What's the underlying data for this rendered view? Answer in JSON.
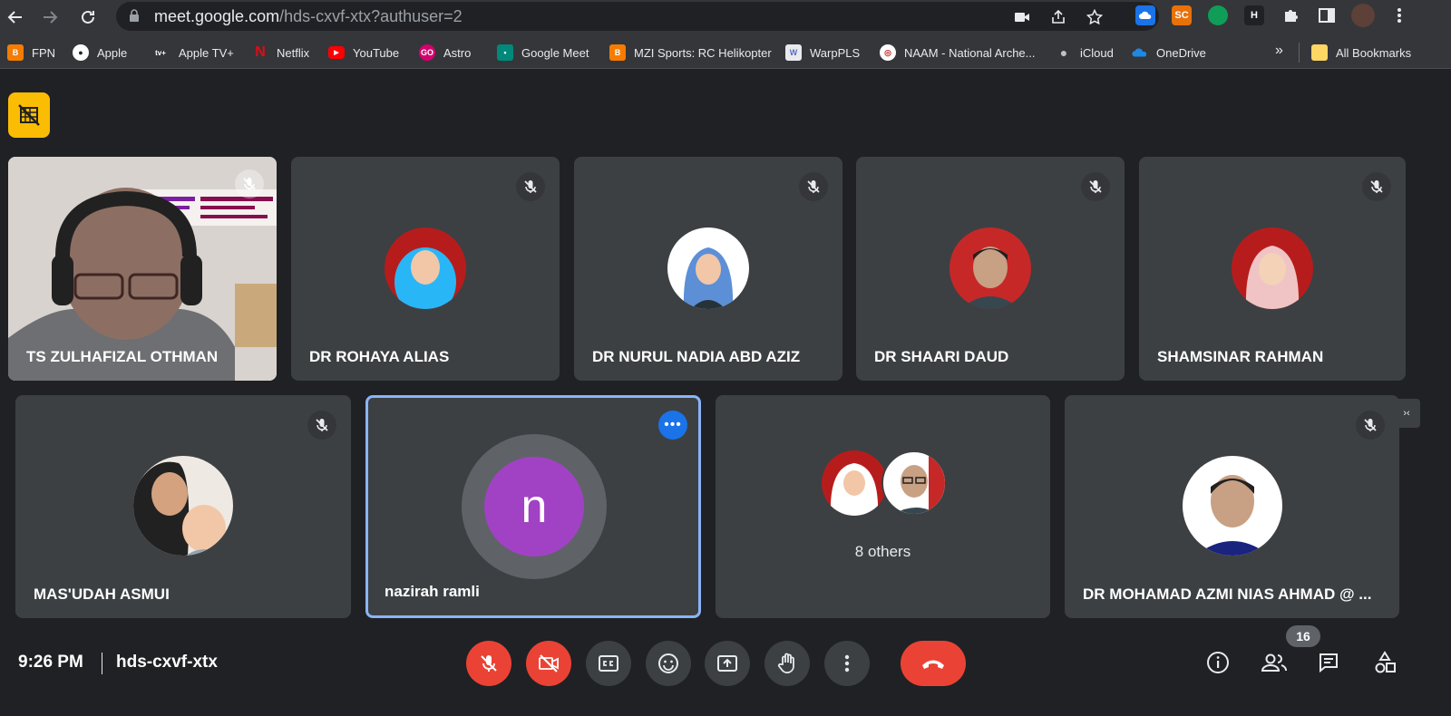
{
  "browser": {
    "url_host": "meet.google.com",
    "url_path": "/hds-cxvf-xtx?authuser=2",
    "extensions": [
      {
        "label": "",
        "color": "#1a73e8"
      },
      {
        "label": "SC",
        "color": "#e8710a"
      },
      {
        "label": "",
        "color": "#0f9d58"
      },
      {
        "label": "H",
        "color": "#202124"
      }
    ],
    "bookmarks": [
      {
        "label": "FPN",
        "icon": "blogger-icon",
        "color": "#f57c00"
      },
      {
        "label": "Apple",
        "icon": "apple-icon",
        "color": "#202124"
      },
      {
        "label": "Apple TV+",
        "icon": "apple-tv-icon",
        "color": "#202124"
      },
      {
        "label": "Netflix",
        "icon": "netflix-icon",
        "color": "#e50914"
      },
      {
        "label": "YouTube",
        "icon": "youtube-icon",
        "color": "#ff0000"
      },
      {
        "label": "Astro",
        "icon": "astro-icon",
        "color": "#d6006f"
      },
      {
        "label": "Google Meet",
        "icon": "google-meet-icon",
        "color": "#00897b"
      },
      {
        "label": "MZI Sports: RC Helikopter",
        "icon": "blogger-icon",
        "color": "#f57c00"
      },
      {
        "label": "WarpPLS",
        "icon": "warppls-icon",
        "color": "#e8eaed"
      },
      {
        "label": "NAAM - National Arche...",
        "icon": "naam-icon",
        "color": "#c62828"
      },
      {
        "label": "iCloud",
        "icon": "apple-icon",
        "color": "#202124"
      },
      {
        "label": "OneDrive",
        "icon": "onedrive-icon",
        "color": "#1e88e5"
      }
    ],
    "overflow_label": "»",
    "all_bookmarks": "All Bookmarks"
  },
  "participants": {
    "row1": [
      {
        "name": "TS ZULHAFIZAL OTHMAN",
        "type": "video"
      },
      {
        "name": "DR ROHAYA ALIAS",
        "type": "avatar",
        "bg": "#b71c1c",
        "fg": "#29b6f6"
      },
      {
        "name": "DR NURUL NADIA ABD AZIZ",
        "type": "avatar",
        "bg": "#ffffff",
        "fg": "#5c8fd6"
      },
      {
        "name": "DR SHAARI DAUD",
        "type": "avatar",
        "bg": "#c62828",
        "fg": "#3e2723"
      },
      {
        "name": "SHAMSINAR RAHMAN",
        "type": "avatar",
        "bg": "#b71c1c",
        "fg": "#f0c4c4"
      }
    ],
    "row2": [
      {
        "name": "MAS'UDAH ASMUI",
        "type": "avatar",
        "bg": "#efe9e4",
        "fg": "#212121"
      },
      {
        "name": "nazirah ramli",
        "type": "letter",
        "letter": "n"
      },
      {
        "name": "",
        "type": "others",
        "others_label": "8 others"
      },
      {
        "name": "DR MOHAMAD AZMI NIAS AHMAD @ ...",
        "type": "avatar",
        "bg": "#ffffff",
        "fg": "#1a237e"
      }
    ]
  },
  "footer": {
    "time": "9:26 PM",
    "meeting_code": "hds-cxvf-xtx",
    "participant_count": "16"
  },
  "colors": {
    "accent_blue": "#8ab4f8",
    "end_red": "#ea4335",
    "warning_yellow": "#fbbc04"
  }
}
